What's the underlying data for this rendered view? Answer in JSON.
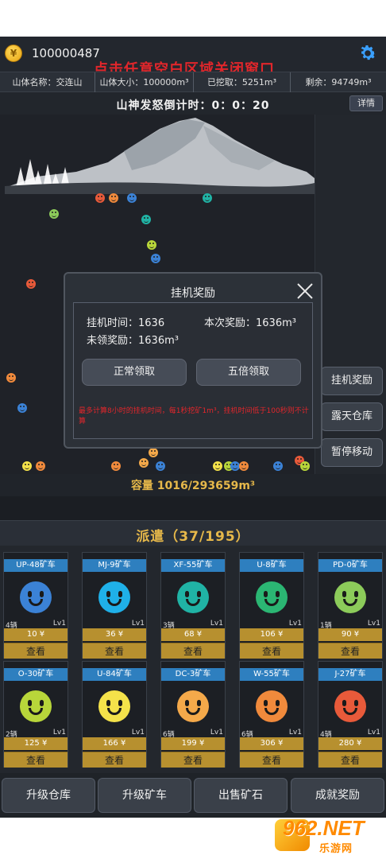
{
  "header": {
    "coin_icon": "coin-icon",
    "coins": "100000487",
    "close_hint": "点击任意空白区域关闭窗口",
    "settings_icon": "gear-icon"
  },
  "info": {
    "mountain_name": "山体名称：交连山",
    "mountain_size": "山体大小：100000m³",
    "mined": "已挖取：5251m³",
    "remaining": "剩余：94749m³"
  },
  "rage": {
    "countdown": "山神发怒倒计时：0：0：20",
    "detail_label": "详情"
  },
  "side_buttons": [
    "挂机奖励",
    "露天仓库",
    "暂停移动"
  ],
  "capacity": "容量 1016/293659m³",
  "dispatch_title": "派遣（37/195）",
  "carts": [
    {
      "name": "UP-48矿车",
      "count": "4辆",
      "level": "Lv1",
      "price": "10 ¥",
      "view": "查看",
      "color": "#3b82d6"
    },
    {
      "name": "MJ-9矿车",
      "count": "",
      "level": "Lv1",
      "price": "36 ¥",
      "view": "查看",
      "color": "#1fb0e8"
    },
    {
      "name": "XF-55矿车",
      "count": "3辆",
      "level": "Lv1",
      "price": "68 ¥",
      "view": "查看",
      "color": "#20b3a5"
    },
    {
      "name": "U-8矿车",
      "count": "",
      "level": "Lv1",
      "price": "106 ¥",
      "view": "查看",
      "color": "#2bb673"
    },
    {
      "name": "PD-0矿车",
      "count": "1辆",
      "level": "Lv1",
      "price": "90 ¥",
      "view": "查看",
      "color": "#8ccb5a"
    },
    {
      "name": "O-30矿车",
      "count": "2辆",
      "level": "Lv1",
      "price": "125 ¥",
      "view": "查看",
      "color": "#b8d63a"
    },
    {
      "name": "U-84矿车",
      "count": "",
      "level": "Lv1",
      "price": "166 ¥",
      "view": "查看",
      "color": "#f4e24a"
    },
    {
      "name": "DC-3矿车",
      "count": "6辆",
      "level": "Lv1",
      "price": "199 ¥",
      "view": "查看",
      "color": "#f4a94a"
    },
    {
      "name": "W-55矿车",
      "count": "6辆",
      "level": "Lv1",
      "price": "306 ¥",
      "view": "查看",
      "color": "#f08a3c"
    },
    {
      "name": "J-27矿车",
      "count": "4辆",
      "level": "Lv1",
      "price": "280 ¥",
      "view": "查看",
      "color": "#e85a3a"
    }
  ],
  "bottom_buttons": [
    "升级仓库",
    "升级矿车",
    "出售矿石",
    "成就奖励"
  ],
  "modal": {
    "title": "挂机奖励",
    "idle_time": "挂机时间：1636",
    "this_reward": "本次奖励：1636m³",
    "unclaimed": "未领奖励：1636m³",
    "normal_claim": "正常领取",
    "double_claim": "五倍领取",
    "note": "最多计算8小时的挂机时间，每1秒挖矿1m³，挂机时间低于100秒则不计算"
  },
  "watermark": {
    "big": "962.NET",
    "small": "乐游网"
  }
}
